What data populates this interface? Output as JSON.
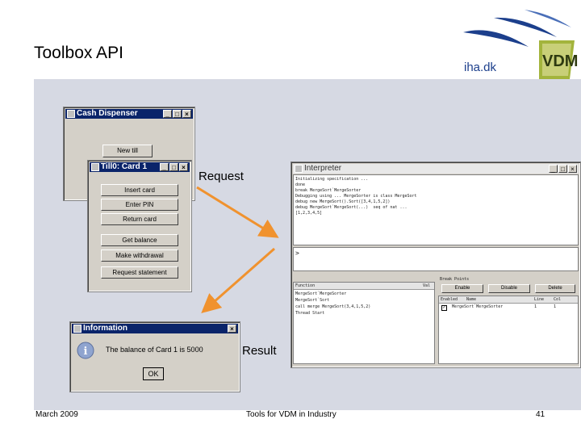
{
  "slide": {
    "title": "Toolbox API",
    "footer_left": "March 2009",
    "footer_center": "Tools for VDM in Industry",
    "footer_right": "41"
  },
  "logo": {
    "text": "iha.dk",
    "mark": "VDM"
  },
  "cash_dispenser": {
    "title": "Cash Dispenser",
    "new_till": "New till"
  },
  "till_window": {
    "title": "Till0: Card 1",
    "buttons": [
      "Insert card",
      "Enter PIN",
      "Return card",
      "Get balance",
      "Make withdrawal",
      "Request statement"
    ]
  },
  "info_dialog": {
    "title": "Information",
    "message": "The balance of Card 1 is 5000",
    "ok": "OK"
  },
  "annotations": {
    "request": "Request",
    "result": "Result"
  },
  "interpreter": {
    "title": "Interpreter",
    "log_lines": [
      "Initializing specification ...",
      "done",
      "break MergeSort`MergeSorter",
      "Debugging using ... MergeSorter is class MergeSort",
      "debug new MergeSort().Sort([3,4,1,5,2])",
      "debug MergeSort`MergeSort(...)  seq of nat ...",
      "[1,2,3,4,5]"
    ],
    "prompt": ">",
    "trace_header": [
      "Function",
      "Val"
    ],
    "trace_rows": [
      "MergeSort`MergeSorter",
      "MergeSort`Sort",
      "call merge MergeSort(3,4,1,5,2)",
      "Thread Start"
    ],
    "breakpoints_title": "Break Points",
    "bp_buttons": [
      "Enable",
      "Disable",
      "Delete"
    ],
    "bp_header": [
      "Enabled",
      "Name",
      "Line",
      "Col"
    ],
    "bp_row": [
      "MergeSort`MergeSorter",
      "1",
      "1"
    ]
  },
  "colors": {
    "titlebar": "#0a246a",
    "arrow": "#f0922e",
    "stage": "#d6d9e3"
  }
}
